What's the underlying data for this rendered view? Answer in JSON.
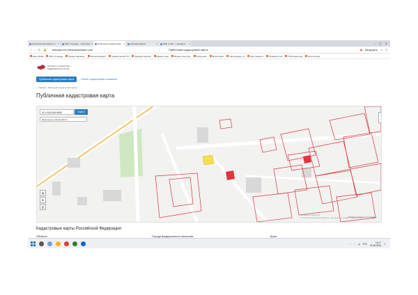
{
  "tabs": [
    {
      "label": "Электронный компас-сп",
      "active": false
    },
    {
      "label": "РФС площадь - электронн",
      "active": false
    },
    {
      "label": "Публичная кадастровая",
      "active": true
    },
    {
      "label": "Личный кабинет",
      "active": false
    },
    {
      "label": "PDF в JPG — Конверте",
      "active": false
    }
  ],
  "browser": {
    "url": "kctnaps.ros.reestracadastre.com",
    "page_title": "Публичная кадастровая карта",
    "download_label": "Загрузить"
  },
  "bookmarks": [
    "Диск WebE",
    "РФС площадь",
    "Предоставление",
    "Личный кабинет",
    "Коммерческие РС",
    "Административн",
    "Единое окно",
    "Водные реестры",
    "Получение",
    "Мониторинг",
    "Населённые пу",
    "Удостоверить",
    "Проверка лиц",
    "Публичная кад",
    "Бесплатные"
  ],
  "site": {
    "logo_lines": [
      "ПОРТАЛ О КАДАСТРЕ",
      "НЕДВИЖИМОСТИ РФ"
    ],
    "tabs": [
      "Публичная кадастровая карта",
      "Расчёт кадастровой стоимости"
    ],
    "breadcrumb": "⌂  Главная  ›  Публичная кадастровая карта",
    "heading": "Публичная кадастровая карта"
  },
  "map": {
    "search_value": "41:1:010104:4640",
    "search_button": "Найти",
    "layer_select": "Земельные участки (ЗУ) ▾",
    "activation_line1": "Активация Windows",
    "activation_line2": "Чтобы активировать Windows, перейдите в раздел \"Параметры\".",
    "footer": "© Росреестр   Условия использования"
  },
  "section": {
    "heading": "Кадастровые карты Российской Федерации",
    "columns": [
      "Области",
      "Города федерального значения",
      "Края"
    ]
  },
  "taskbar": {
    "lang": "РУС",
    "time": "14:17",
    "date": "22.06.2024"
  },
  "colors": {
    "accent": "#2d7bbf",
    "parcel_border": "#d9333b",
    "selected_parcel": "#e0343e",
    "highlight_parcel": "#f3e04e",
    "park": "#cfe8c2"
  }
}
